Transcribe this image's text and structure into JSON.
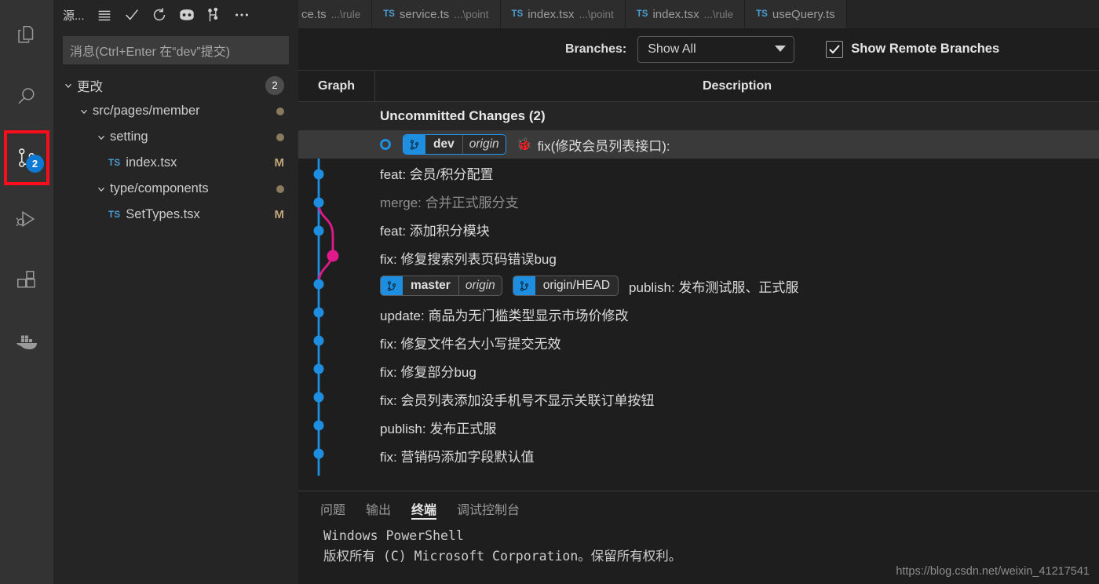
{
  "activity_bar": {
    "items": [
      {
        "name": "explorer",
        "icon": "files-icon",
        "badge": ""
      },
      {
        "name": "search",
        "icon": "search-icon",
        "badge": ""
      },
      {
        "name": "source-control",
        "icon": "source-control-icon",
        "badge": "2",
        "selected": true,
        "highlighted": true
      },
      {
        "name": "run-and-debug",
        "icon": "run-debug-icon",
        "badge": ""
      },
      {
        "name": "extensions",
        "icon": "extensions-icon",
        "badge": ""
      },
      {
        "name": "docker",
        "icon": "docker-icon",
        "badge": ""
      }
    ],
    "highlight_color": "#fc0d1b",
    "badge_color": "#0e7ad4"
  },
  "sidebar": {
    "title": "源...",
    "toolbar": [
      {
        "name": "view-as-list-icon",
        "label": "视图"
      },
      {
        "name": "commit-check-icon",
        "label": "提交"
      },
      {
        "name": "refresh-icon",
        "label": "刷新"
      },
      {
        "name": "github-icon",
        "label": "GitHub"
      },
      {
        "name": "git-graph-icon",
        "label": "Git Graph"
      },
      {
        "name": "more-actions-icon",
        "label": "..."
      }
    ],
    "commit_input": {
      "value": "",
      "placeholder": "消息(Ctrl+Enter 在“dev”提交)"
    },
    "tree": [
      {
        "label": "更改",
        "indent": 0,
        "chevron": "down",
        "decoration": "2",
        "decoration_type": "count",
        "file_icon": ""
      },
      {
        "label": "src/pages/member",
        "indent": 1,
        "chevron": "down",
        "decoration": "",
        "decoration_type": "dot",
        "file_icon": ""
      },
      {
        "label": "setting",
        "indent": 2,
        "chevron": "down",
        "decoration": "",
        "decoration_type": "dot",
        "file_icon": ""
      },
      {
        "label": "index.tsx",
        "indent": 3,
        "chevron": "none",
        "decoration": "M",
        "decoration_type": "status",
        "file_icon": "TS"
      },
      {
        "label": "type/components",
        "indent": 2,
        "chevron": "down",
        "decoration": "",
        "decoration_type": "dot",
        "file_icon": ""
      },
      {
        "label": "SetTypes.tsx",
        "indent": 3,
        "chevron": "none",
        "decoration": "M",
        "decoration_type": "status",
        "file_icon": "TS"
      }
    ]
  },
  "tabs": [
    {
      "icon": "",
      "name": "ce.ts",
      "path": "...\\rule",
      "active": false,
      "clipped": true
    },
    {
      "icon": "TS",
      "name": "service.ts",
      "path": "...\\point",
      "active": false
    },
    {
      "icon": "TS",
      "name": "index.tsx",
      "path": "...\\point",
      "active": false
    },
    {
      "icon": "TS",
      "name": "index.tsx",
      "path": "...\\rule",
      "active": false
    },
    {
      "icon": "TS",
      "name": "useQuery.ts",
      "path": "",
      "active": false
    }
  ],
  "git_graph": {
    "branches_label": "Branches:",
    "branches_value": "Show All",
    "show_remote_branches_label": "Show Remote Branches",
    "show_remote_branches_checked": true,
    "columns": {
      "graph": "Graph",
      "description": "Description"
    },
    "commits": [
      {
        "description": "Uncommitted Changes (2)",
        "type": "uncommitted",
        "refs": [],
        "head": false,
        "emoji": "",
        "selected": false,
        "node_color": "#9a9a9a",
        "node_filled": false
      },
      {
        "description": "fix(修改会员列表接口):",
        "type": "commit",
        "refs": [
          {
            "name": "dev",
            "remote": "origin",
            "head": true
          }
        ],
        "head": true,
        "emoji": "🐞",
        "selected": true,
        "node_color": "#1e8fe0",
        "node_filled": true
      },
      {
        "description": "feat: 会员/积分配置",
        "type": "commit",
        "refs": [],
        "head": false,
        "emoji": "",
        "selected": false,
        "node_color": "#1e8fe0",
        "node_filled": true
      },
      {
        "description": "merge: 合并正式服分支",
        "type": "merge",
        "refs": [],
        "head": false,
        "emoji": "",
        "selected": false,
        "node_color": "#1e8fe0",
        "node_filled": true
      },
      {
        "description": "feat: 添加积分模块",
        "type": "commit",
        "refs": [],
        "head": false,
        "emoji": "",
        "selected": false,
        "node_color": "#1e8fe0",
        "node_filled": true
      },
      {
        "description": "fix: 修复搜索列表页码错误bug",
        "type": "commit",
        "refs": [],
        "head": false,
        "emoji": "",
        "selected": false,
        "node_color": "#e01a8c",
        "node_filled": true
      },
      {
        "description": "publish: 发布测试服、正式服",
        "type": "commit",
        "refs": [
          {
            "name": "master",
            "remote": "origin",
            "head": false
          },
          {
            "name": "origin/HEAD",
            "remote": "",
            "head": false
          }
        ],
        "head": false,
        "emoji": "",
        "selected": false,
        "node_color": "#1e8fe0",
        "node_filled": true
      },
      {
        "description": "update: 商品为无门槛类型显示市场价修改",
        "type": "commit",
        "refs": [],
        "head": false,
        "emoji": "",
        "selected": false,
        "node_color": "#1e8fe0",
        "node_filled": true
      },
      {
        "description": "fix: 修复文件名大小写提交无效",
        "type": "commit",
        "refs": [],
        "head": false,
        "emoji": "",
        "selected": false,
        "node_color": "#1e8fe0",
        "node_filled": true
      },
      {
        "description": "fix: 修复部分bug",
        "type": "commit",
        "refs": [],
        "head": false,
        "emoji": "",
        "selected": false,
        "node_color": "#1e8fe0",
        "node_filled": true
      },
      {
        "description": "fix: 会员列表添加没手机号不显示关联订单按钮",
        "type": "commit",
        "refs": [],
        "head": false,
        "emoji": "",
        "selected": false,
        "node_color": "#1e8fe0",
        "node_filled": true
      },
      {
        "description": "publish: 发布正式服",
        "type": "commit",
        "refs": [],
        "head": false,
        "emoji": "",
        "selected": false,
        "node_color": "#1e8fe0",
        "node_filled": true
      },
      {
        "description": "fix: 营销码添加字段默认值",
        "type": "commit",
        "refs": [],
        "head": false,
        "emoji": "",
        "selected": false,
        "node_color": "#1e8fe0",
        "node_filled": true
      }
    ],
    "colors": {
      "main_branch": "#1e8fe0",
      "side_branch": "#e01a8c",
      "uncommitted": "#9a9a9a"
    }
  },
  "panel": {
    "tabs": [
      {
        "label": "问题",
        "active": false
      },
      {
        "label": "输出",
        "active": false
      },
      {
        "label": "终端",
        "active": true
      },
      {
        "label": "调试控制台",
        "active": false
      }
    ],
    "terminal_lines": [
      "Windows PowerShell",
      "版权所有 (C) Microsoft Corporation。保留所有权利。"
    ]
  },
  "watermark": "https://blog.csdn.net/weixin_41217541"
}
